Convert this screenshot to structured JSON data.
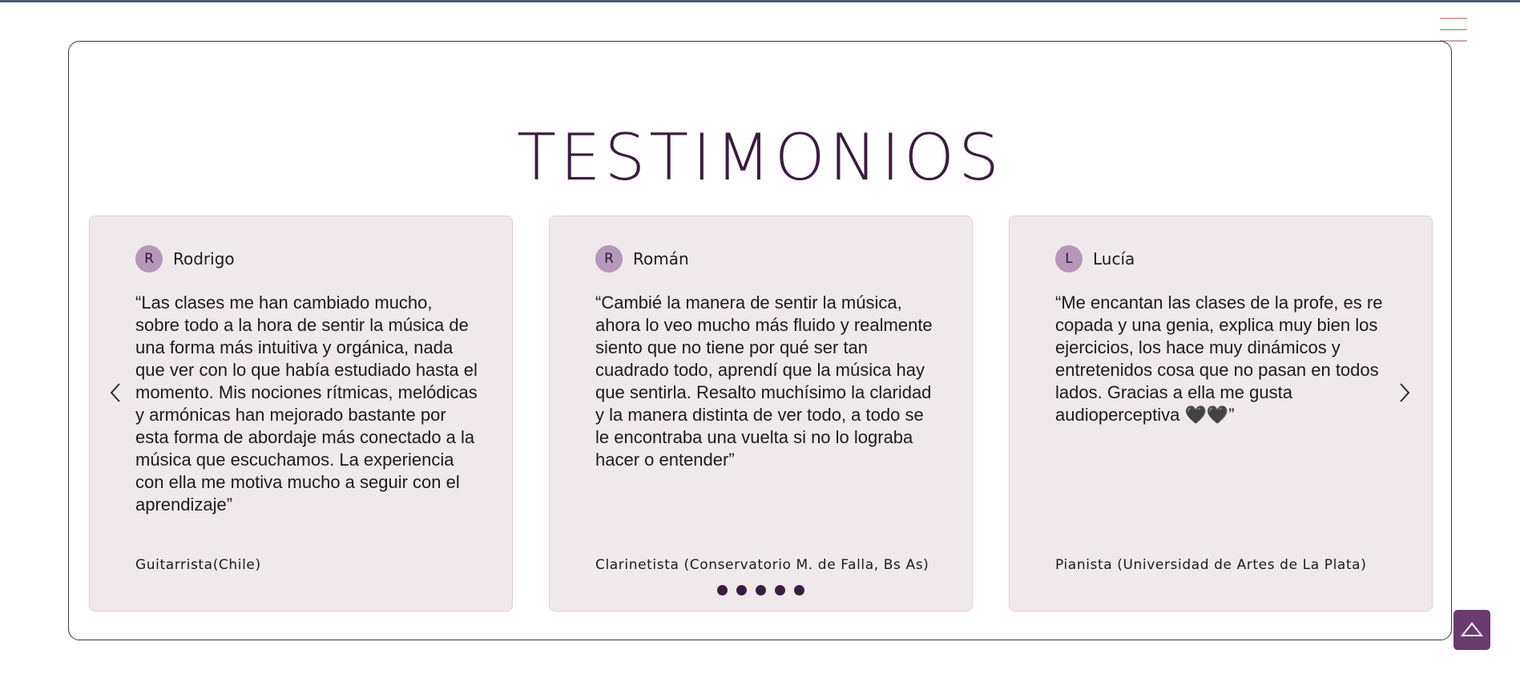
{
  "header": {
    "menu_icon": "hamburger-icon"
  },
  "section": {
    "title": "TESTIMONIOS"
  },
  "testimonials": [
    {
      "initial": "R",
      "name": "Rodrigo",
      "quote": "“Las clases me han cambiado mucho, sobre todo a la hora de sentir la música de una forma más intuitiva y orgánica, nada que ver con lo que había estudiado hasta el momento. Mis nociones rítmicas, melódicas y armónicas han mejorado bastante por esta forma de abordaje más conectado a la música que escuchamos. La experiencia con ella me motiva mucho a seguir con el aprendizaje”",
      "role": "Guitarrista(Chile)"
    },
    {
      "initial": "R",
      "name": "Román",
      "quote": "“Cambié la manera de sentir la música, ahora lo veo mucho más fluido y realmente siento que no tiene por qué ser tan cuadrado todo, aprendí que la música hay que sentirla. Resalto muchísimo la claridad y la manera distinta de ver todo, a todo se le encontraba una vuelta si no lo lograba hacer o entender”",
      "role": "Clarinetista (Conservatorio M. de Falla, Bs As)"
    },
    {
      "initial": "L",
      "name": "Lucía",
      "quote": "“Me encantan las clases de la profe, es re copada y una genia, explica muy bien los ejercicios, los hace muy dinámicos y entretenidos cosa que no pasan en todos lados. Gracias a ella me gusta audioperceptiva 🖤🖤”",
      "role": "Pianista (Universidad de Artes de La Plata)"
    }
  ],
  "carousel": {
    "prev_icon": "chevron-left-icon",
    "next_icon": "chevron-right-icon",
    "dot_count": 5
  },
  "scroll_top": {
    "icon": "triangle-up-icon"
  },
  "colors": {
    "title": "#3a1d3e",
    "card_bg": "#f0e9eb",
    "avatar_bg": "#b597b9",
    "accent": "#6a3b6f",
    "menu": "#d4a5a9"
  }
}
